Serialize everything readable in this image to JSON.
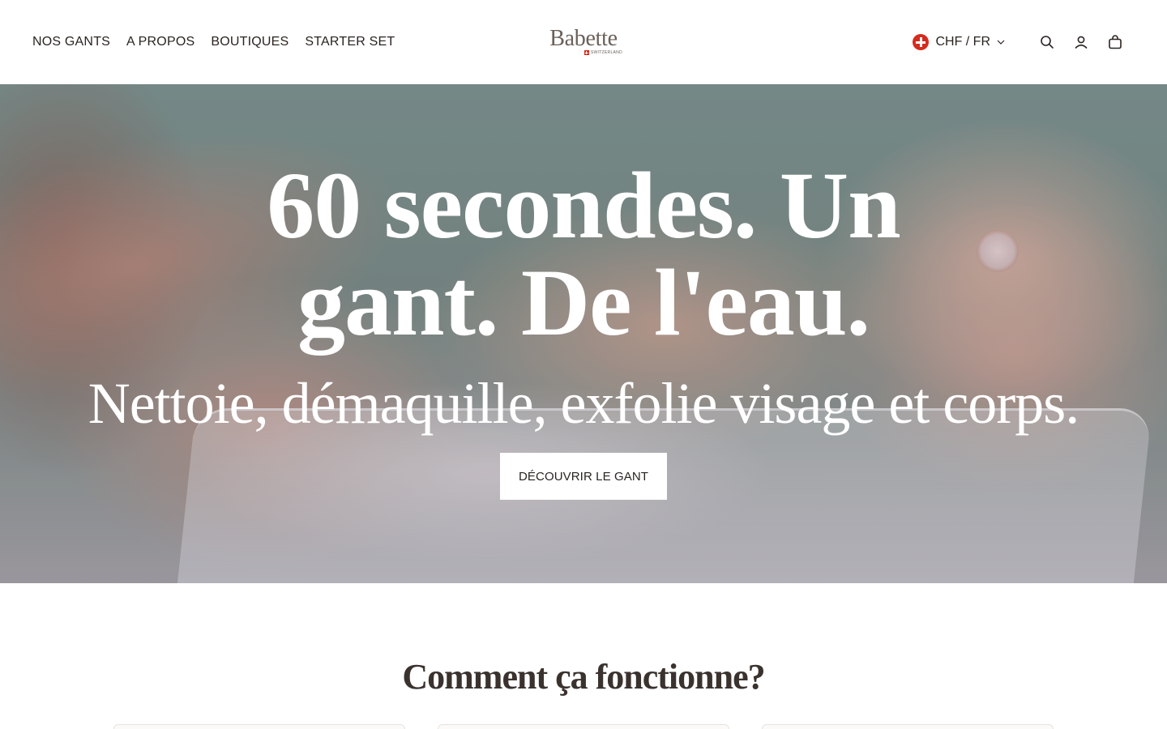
{
  "header": {
    "nav": [
      "NOS GANTS",
      "A PROPOS",
      "BOUTIQUES",
      "STARTER SET"
    ],
    "logo": {
      "wordmark": "Babette",
      "country": "SWITZERLAND"
    },
    "locale": {
      "label": "CHF / FR",
      "flag_icon": "swiss-flag-icon"
    },
    "icons": [
      "search-icon",
      "account-icon",
      "cart-icon"
    ]
  },
  "hero": {
    "title": "60 secondes. Un gant. De l'eau.",
    "subtitle": "Nettoie, démaquille, exfolie visage et corps.",
    "cta": "DÉCOUVRIR LE GANT"
  },
  "how": {
    "title": "Comment ça fonctionne?"
  },
  "colors": {
    "text": "#2a2420",
    "logo": "#6b605a",
    "swiss_red": "#d52b1e",
    "hero_text": "#ffffff"
  }
}
